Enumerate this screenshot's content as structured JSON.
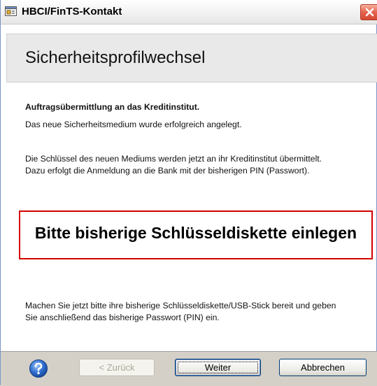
{
  "window": {
    "title": "HBCI/FinTS-Kontakt",
    "icons": {
      "app": "app-window-icon",
      "close": "close-icon"
    }
  },
  "header": {
    "title": "Sicherheitsprofilwechsel"
  },
  "body": {
    "heading": "Auftragsübermittlung an das Kreditinstitut.",
    "line1": "Das neue Sicherheitsmedium wurde erfolgreich angelegt.",
    "line2": "Die Schlüssel des neuen Mediums werden jetzt an ihr Kreditinstitut übermittelt.",
    "line3": "Dazu erfolgt die Anmeldung an die Bank mit der bisherigen PIN (Passwort).",
    "highlight": "Bitte bisherige Schlüsseldiskette einlegen",
    "line4": "Machen Sie jetzt bitte ihre bisherige Schlüsseldiskette/USB-Stick bereit und geben",
    "line5": "Sie anschließend das bisherige Passwort (PIN) ein."
  },
  "buttons": {
    "back": "< Zurück",
    "next": "Weiter",
    "cancel": "Abbrechen",
    "help_icon": "help-icon"
  },
  "colors": {
    "highlight_border": "#d40000",
    "button_border": "#003c74",
    "bottom_bar": "#d4d0c8"
  }
}
